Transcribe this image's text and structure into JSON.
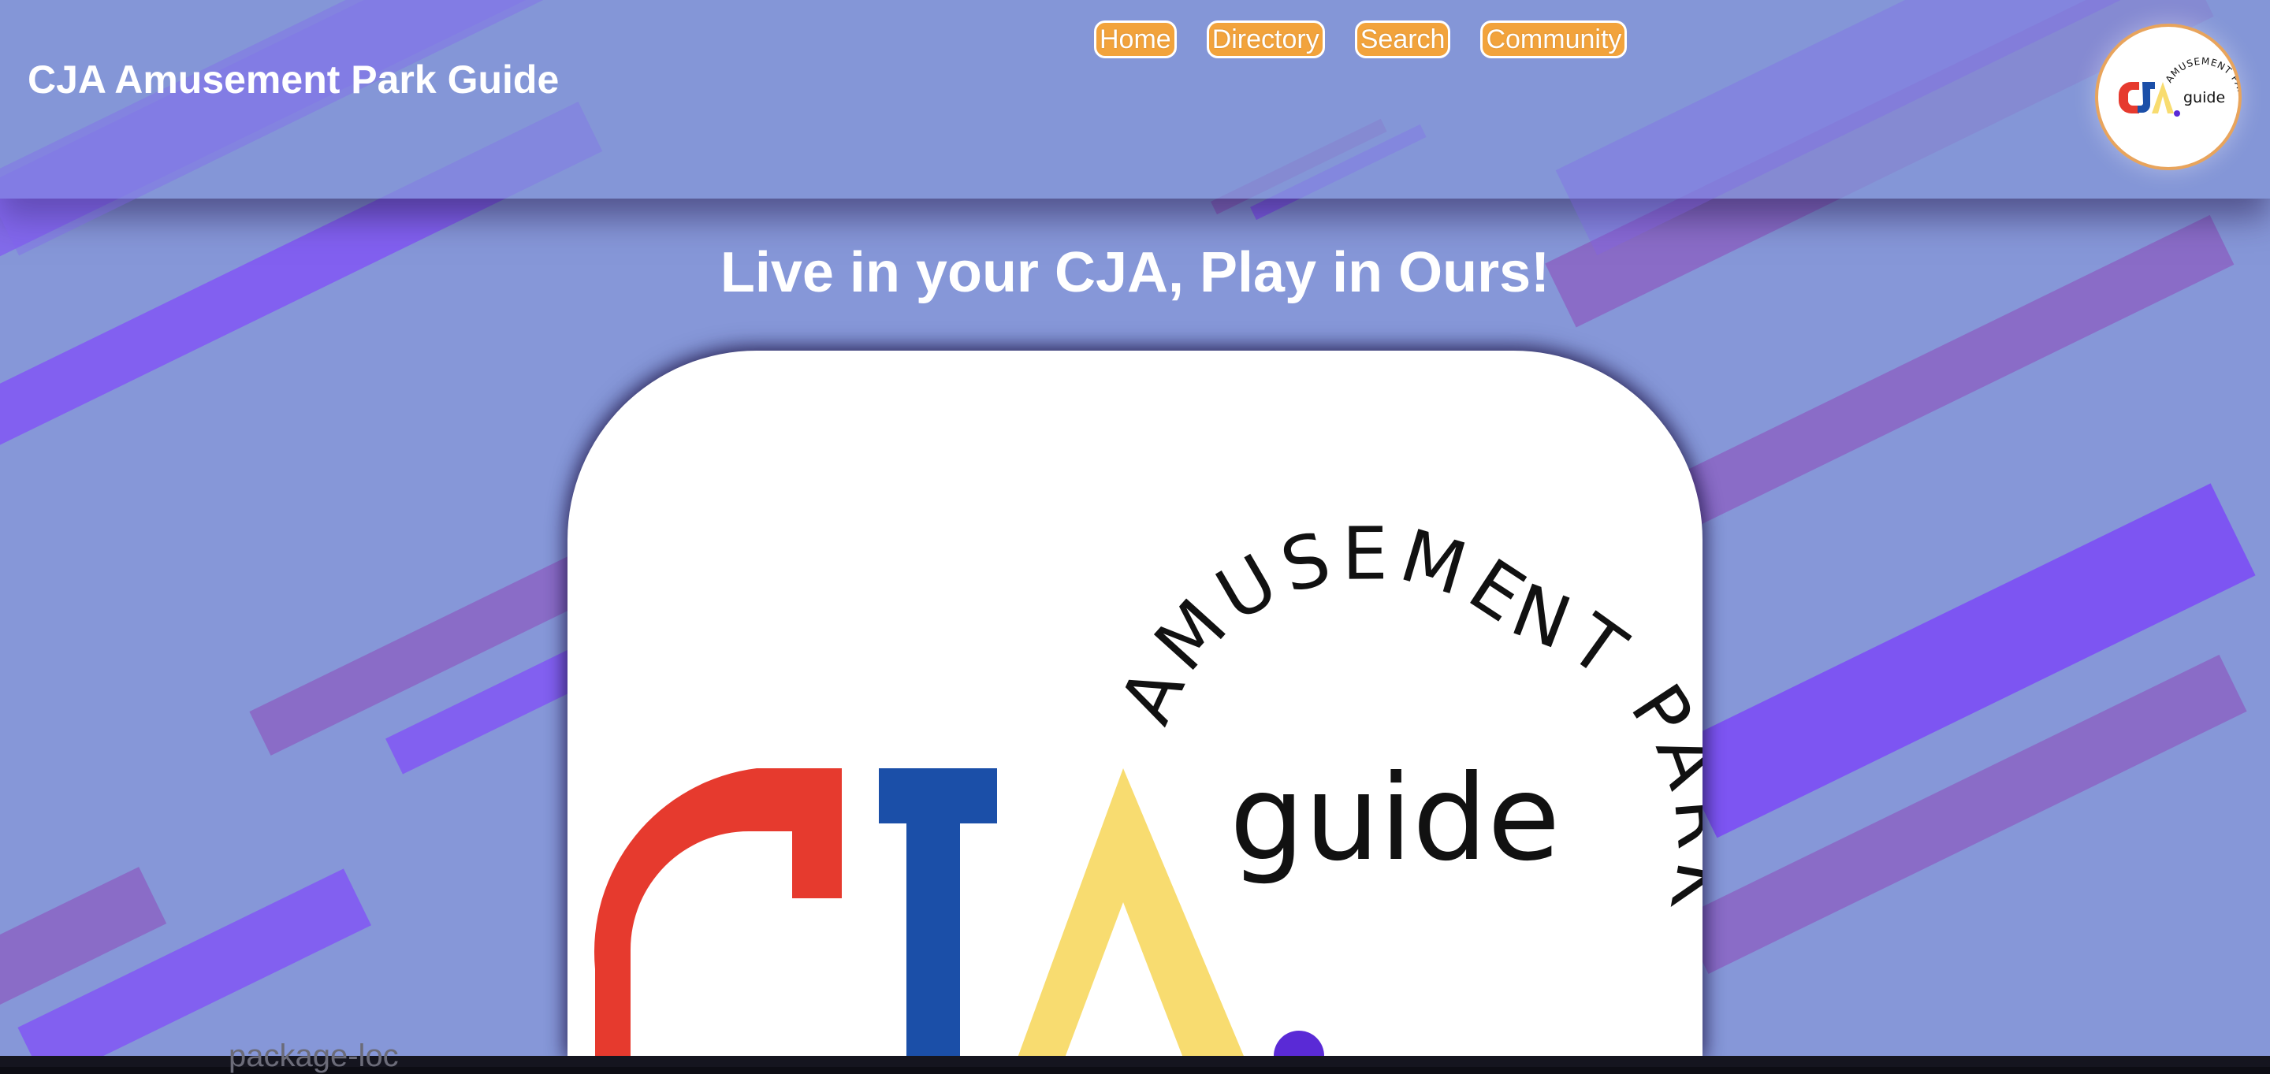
{
  "site": {
    "title": "CJA Amusement Park Guide"
  },
  "nav": {
    "items": [
      {
        "label": "Home"
      },
      {
        "label": "Directory"
      },
      {
        "label": "Search"
      },
      {
        "label": "Community"
      }
    ]
  },
  "hero": {
    "tagline": "Live in your CJA, Play in Ours!"
  },
  "logo": {
    "letters": [
      "C",
      "J",
      "A"
    ],
    "word": "guide",
    "arc_text": "AMUSEMENT PARK"
  },
  "taskbar": {
    "text": "package-loc"
  },
  "colors": {
    "background": "#8697d8",
    "nav_button": "#f2a33c",
    "logo_red": "#e63a2e",
    "logo_blue": "#1b4fa8",
    "logo_yellow": "#f8dc70",
    "logo_dot": "#5a2ad6",
    "stripe_violet": "#8260f0",
    "stripe_mauve": "#8a6cc7"
  }
}
